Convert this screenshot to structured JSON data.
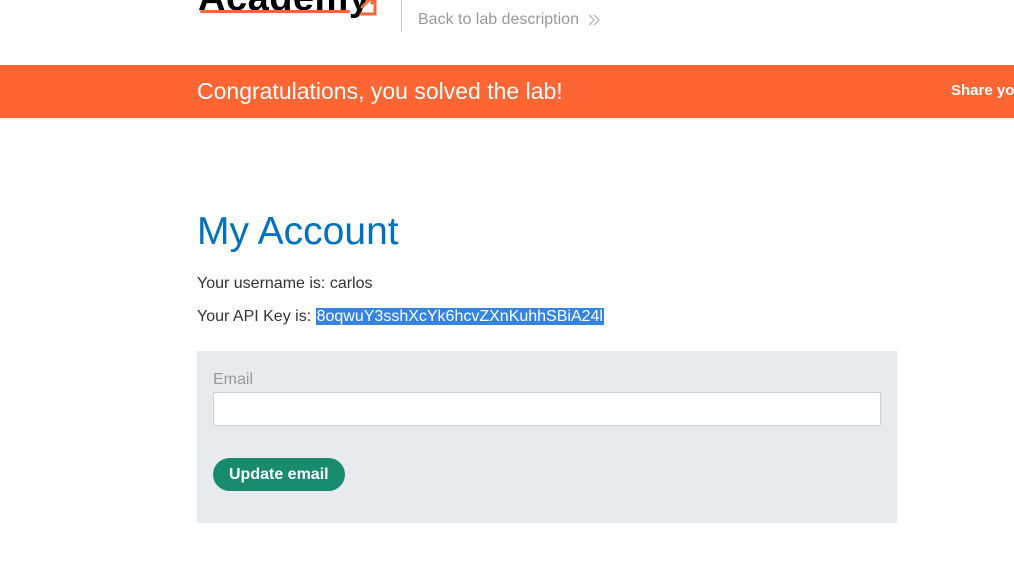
{
  "header": {
    "logo_text": "Academy",
    "back_link_label": "Back to lab description",
    "colors": {
      "accent": "#ff6633"
    }
  },
  "banner": {
    "title": "Congratulations, you solved the lab!",
    "share_label": "Share yo",
    "background_color": "#ff6633"
  },
  "main": {
    "page_title": "My Account",
    "username_prefix": "Your username is: ",
    "username": "carlos",
    "api_key_prefix": "Your API Key is: ",
    "api_key": "8oqwuY3sshXcYk6hcvZXnKuhhSBiA24l",
    "title_color": "#0071bc"
  },
  "form": {
    "email_label": "Email",
    "email_value": "",
    "email_placeholder": "",
    "submit_label": "Update email",
    "button_color": "#188a6e"
  },
  "icons": {
    "logo_mark": "portswigger-arrow-icon",
    "back_link_chevron": "double-chevron-right-icon"
  }
}
